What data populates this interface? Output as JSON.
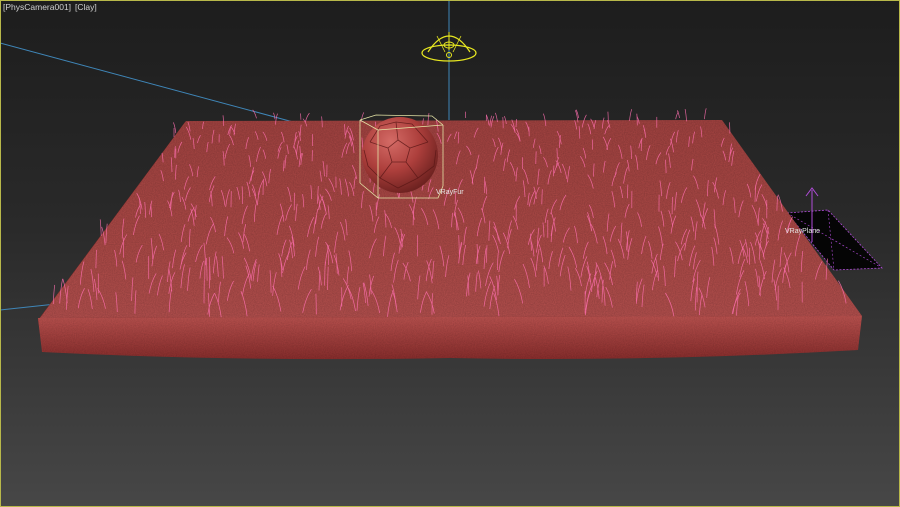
{
  "viewport": {
    "camera_menu": "[PhysCamera001]",
    "shading_menu": "[Clay]"
  },
  "objects": {
    "fur_label": "VRayFur",
    "plane_light_label": "VRayPlane"
  },
  "colors": {
    "viewport_border": "#b8b84a",
    "ground": "#b54846",
    "fur_strands": "#ff6fb0",
    "selection_box": "#e4e4a6",
    "camera_line": "#3f86b8",
    "dome_light": "#e8e820",
    "light_gizmo": "#b04cd8"
  }
}
